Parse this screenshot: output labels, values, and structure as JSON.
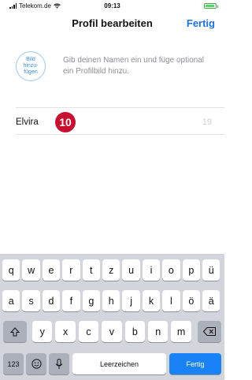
{
  "status_bar": {
    "carrier": "Telekom.de",
    "time": "09:13",
    "battery_level": 0.9
  },
  "nav": {
    "title": "Profil bearbeiten",
    "done_label": "Fertig"
  },
  "profile": {
    "photo_label": "Bild\nhinzu-\nfügen",
    "hint": "Gib deinen Namen ein und füge optional ein Profilbild hinzu."
  },
  "name_field": {
    "value": "Elvira",
    "remaining_chars": "19"
  },
  "annotation": {
    "step": "10",
    "color": "#c8102e"
  },
  "keyboard": {
    "row1": [
      "q",
      "w",
      "e",
      "r",
      "t",
      "z",
      "u",
      "i",
      "o",
      "p",
      "ü"
    ],
    "row2": [
      "a",
      "s",
      "d",
      "f",
      "g",
      "h",
      "j",
      "k",
      "l",
      "ö",
      "ä"
    ],
    "row3": [
      "y",
      "x",
      "c",
      "v",
      "b",
      "n",
      "m"
    ],
    "numbers_label": "123",
    "space_label": "Leerzeichen",
    "return_label": "Fertig",
    "shift_icon": "shift-icon",
    "delete_icon": "delete-icon",
    "emoji_icon": "emoji-icon",
    "mic_icon": "microphone-icon",
    "accent_color": "#1a82f7"
  }
}
